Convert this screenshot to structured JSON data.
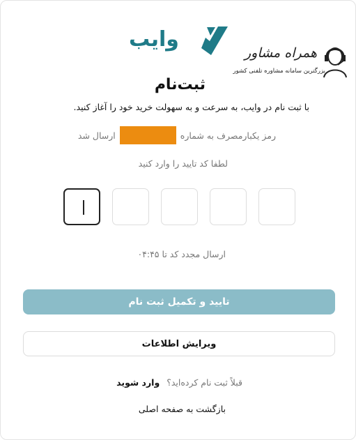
{
  "brand": {
    "logo_text": "وایب",
    "logo_color": "#1f7b88",
    "logo_icon": "checkmark-icon"
  },
  "watermark": {
    "title": "همراه مشاور",
    "subtitle": "بزرگترین سامانه مشاوره تلفنی کشور",
    "icon": "headset-person-icon"
  },
  "form": {
    "title": "ثبت‌نام",
    "subtitle": "با ثبت نام در وایب، به سرعت و به سهولت خرید خود را آغاز کنید.",
    "otp_sent_prefix": "رمز یکبارمصرف به شماره",
    "otp_sent_suffix": "ارسال شد",
    "phone_mask_color": "#ec8c10",
    "enter_code": "لطفا کد تایید را وارد کنید",
    "otp_digits": [
      "",
      "",
      "",
      "",
      "",
      ""
    ],
    "resend_text": "ارسال مجدد کد تا ۰۴:۴۵"
  },
  "buttons": {
    "confirm_label": "تایید و تکمیل ثبت نام",
    "confirm_color": "#8bbcc8",
    "edit_label": "ویرایش اطلاعات"
  },
  "footer": {
    "already_registered": "قبلاً ثبت نام کرده‌اید؟",
    "login_link": "وارد شوید",
    "back_link": "بازگشت به صفحه اصلی"
  }
}
